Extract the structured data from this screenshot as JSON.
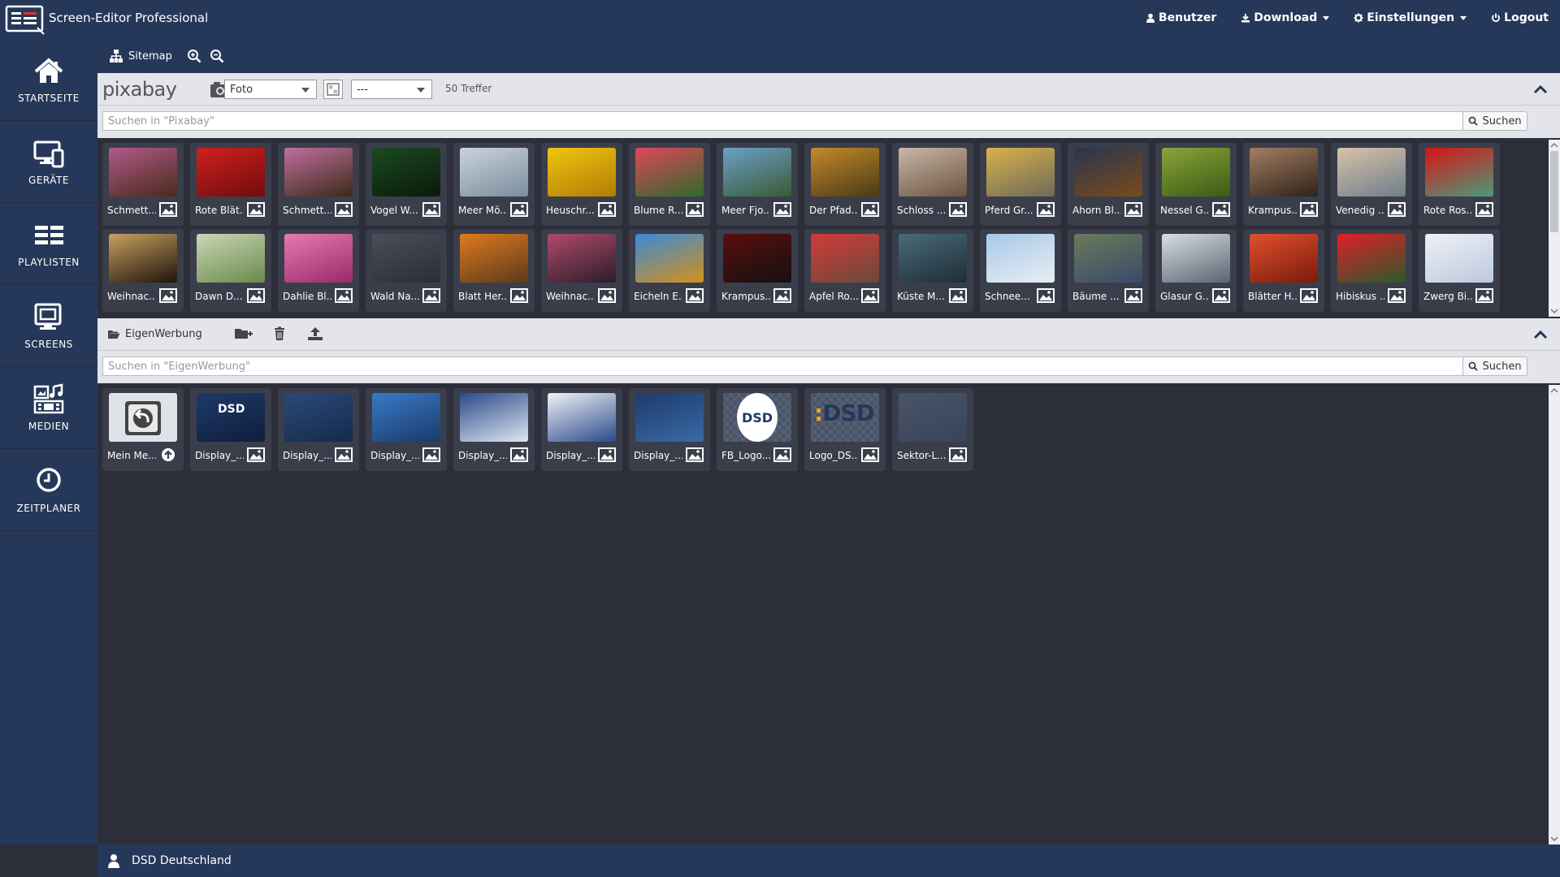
{
  "app": {
    "title": "Screen-Editor Professional"
  },
  "topnav": [
    {
      "label": "Benutzer",
      "icon": "user-icon"
    },
    {
      "label": "Download",
      "icon": "download-icon",
      "dropdown": true
    },
    {
      "label": "Einstellungen",
      "icon": "gear-icon",
      "dropdown": true
    },
    {
      "label": "Logout",
      "icon": "power-icon"
    }
  ],
  "sidebar": {
    "items": [
      {
        "label": "STARTSEITE",
        "icon": "home-icon"
      },
      {
        "label": "GERÄTE",
        "icon": "devices-icon"
      },
      {
        "label": "PLAYLISTEN",
        "icon": "playlist-icon"
      },
      {
        "label": "SCREENS",
        "icon": "screens-icon"
      },
      {
        "label": "MEDIEN",
        "icon": "media-icon"
      },
      {
        "label": "ZEITPLANER",
        "icon": "clock-icon"
      }
    ]
  },
  "toolbar": {
    "sitemap_label": "Sitemap"
  },
  "pixabay": {
    "logo": "pixabay",
    "type_select": "Foto",
    "filter_select": "---",
    "hits": "50 Treffer",
    "search_placeholder": "Suchen in \"Pixabay\"",
    "search_button": "Suchen",
    "tiles": [
      {
        "label": "Schmett...",
        "c1": "#b05a8a",
        "c2": "#4a2a1a"
      },
      {
        "label": "Rote Blät...",
        "c1": "#d21f1f",
        "c2": "#6e0d0d"
      },
      {
        "label": "Schmett...",
        "c1": "#c06fa0",
        "c2": "#3b2a18"
      },
      {
        "label": "Vogel W...",
        "c1": "#1a4a20",
        "c2": "#0b1a0c"
      },
      {
        "label": "Meer Mö...",
        "c1": "#c9d3dc",
        "c2": "#7b8d9c"
      },
      {
        "label": "Heuschr...",
        "c1": "#f1c40f",
        "c2": "#b07d05"
      },
      {
        "label": "Blume R...",
        "c1": "#e0465a",
        "c2": "#2d6a2a"
      },
      {
        "label": "Meer Fjo...",
        "c1": "#6aa0c8",
        "c2": "#3b5a34"
      },
      {
        "label": "Der Pfad...",
        "c1": "#c48a2a",
        "c2": "#4a3a14"
      },
      {
        "label": "Schloss ...",
        "c1": "#c9b7a7",
        "c2": "#6b5342"
      },
      {
        "label": "Pferd Gr...",
        "c1": "#d8b24a",
        "c2": "#6e6a5a"
      },
      {
        "label": "Ahorn Bl...",
        "c1": "#2a3550",
        "c2": "#7a4a1a"
      },
      {
        "label": "Nessel G...",
        "c1": "#8aa43a",
        "c2": "#3b5a14"
      },
      {
        "label": "Krampus...",
        "c1": "#a47e62",
        "c2": "#2e221a"
      },
      {
        "label": "Venedig ...",
        "c1": "#d8c2a8",
        "c2": "#6e7e8a"
      },
      {
        "label": "Rote Ros...",
        "c1": "#d81414",
        "c2": "#4a9a7a"
      },
      {
        "label": "Weihnac...",
        "c1": "#c8a060",
        "c2": "#1e140a"
      },
      {
        "label": "Dawn D...",
        "c1": "#cad6b6",
        "c2": "#6a8a4a"
      },
      {
        "label": "Dahlie Bl...",
        "c1": "#e47ab0",
        "c2": "#9a2a6a"
      },
      {
        "label": "Wald Na...",
        "c1": "#4a4e58",
        "c2": "#2a2e36"
      },
      {
        "label": "Blatt Her...",
        "c1": "#e07a20",
        "c2": "#5a3a1a"
      },
      {
        "label": "Weihnac...",
        "c1": "#b04a6a",
        "c2": "#2a1e2a"
      },
      {
        "label": "Eicheln E...",
        "c1": "#3a8ad8",
        "c2": "#d4901a"
      },
      {
        "label": "Krampus...",
        "c1": "#5a0e0e",
        "c2": "#141010"
      },
      {
        "label": "Apfel Ro...",
        "c1": "#d23a3a",
        "c2": "#6a4a3a"
      },
      {
        "label": "Küste M...",
        "c1": "#4a6a7a",
        "c2": "#1e2e36"
      },
      {
        "label": "Schnee...",
        "c1": "#a8c8e8",
        "c2": "#e8eef4"
      },
      {
        "label": "Bäume ...",
        "c1": "#6a7a5a",
        "c2": "#3a4a6a"
      },
      {
        "label": "Glasur G...",
        "c1": "#d8dee4",
        "c2": "#5a6470"
      },
      {
        "label": "Blätter H...",
        "c1": "#e05030",
        "c2": "#7a1a0a"
      },
      {
        "label": "Hibiskus ...",
        "c1": "#e01e2a",
        "c2": "#2a5a2a"
      },
      {
        "label": "Zwerg Bi...",
        "c1": "#eef2f8",
        "c2": "#bcc8dc"
      }
    ]
  },
  "eigenwerbung": {
    "folder_label": "EigenWerbung",
    "search_placeholder": "Suchen in \"EigenWerbung\"",
    "search_button": "Suchen",
    "tiles": [
      {
        "label": "Mein Me...",
        "kind": "folder-up"
      },
      {
        "label": "Display_...",
        "kind": "image",
        "c1": "#1e3a6a",
        "c2": "#0e1e3a",
        "text": "DSD"
      },
      {
        "label": "Display_...",
        "kind": "image",
        "c1": "#2a4a7a",
        "c2": "#152a4a",
        "text": ""
      },
      {
        "label": "Display_...",
        "kind": "image",
        "c1": "#3a7ac8",
        "c2": "#1a3a6a",
        "text": ""
      },
      {
        "label": "Display_...",
        "kind": "image",
        "c1": "#2a4a8a",
        "c2": "#dfe6f0",
        "text": ""
      },
      {
        "label": "Display_...",
        "kind": "image",
        "c1": "#f0f2f6",
        "c2": "#2a4a8a",
        "text": ""
      },
      {
        "label": "Display_...",
        "kind": "image",
        "c1": "#1e3a6a",
        "c2": "#3a6aa8",
        "text": ""
      },
      {
        "label": "FB_Logo...",
        "kind": "logo",
        "c1": "#ffffff",
        "c2": "#1e3a6a",
        "text": "DSD"
      },
      {
        "label": "Logo_DS...",
        "kind": "logo-wide",
        "c1": "#5a6478",
        "c2": "#3a4458",
        "text": "DSD"
      },
      {
        "label": "Sektor-L...",
        "kind": "image",
        "c1": "#4a5468",
        "c2": "#3a4458",
        "text": ""
      }
    ]
  },
  "footer": {
    "company": "DSD Deutschland"
  },
  "colors": {
    "accent": "#263859",
    "panel": "#e3e5ea",
    "tile": "#3a3e4b",
    "background": "#2c2f3a"
  }
}
